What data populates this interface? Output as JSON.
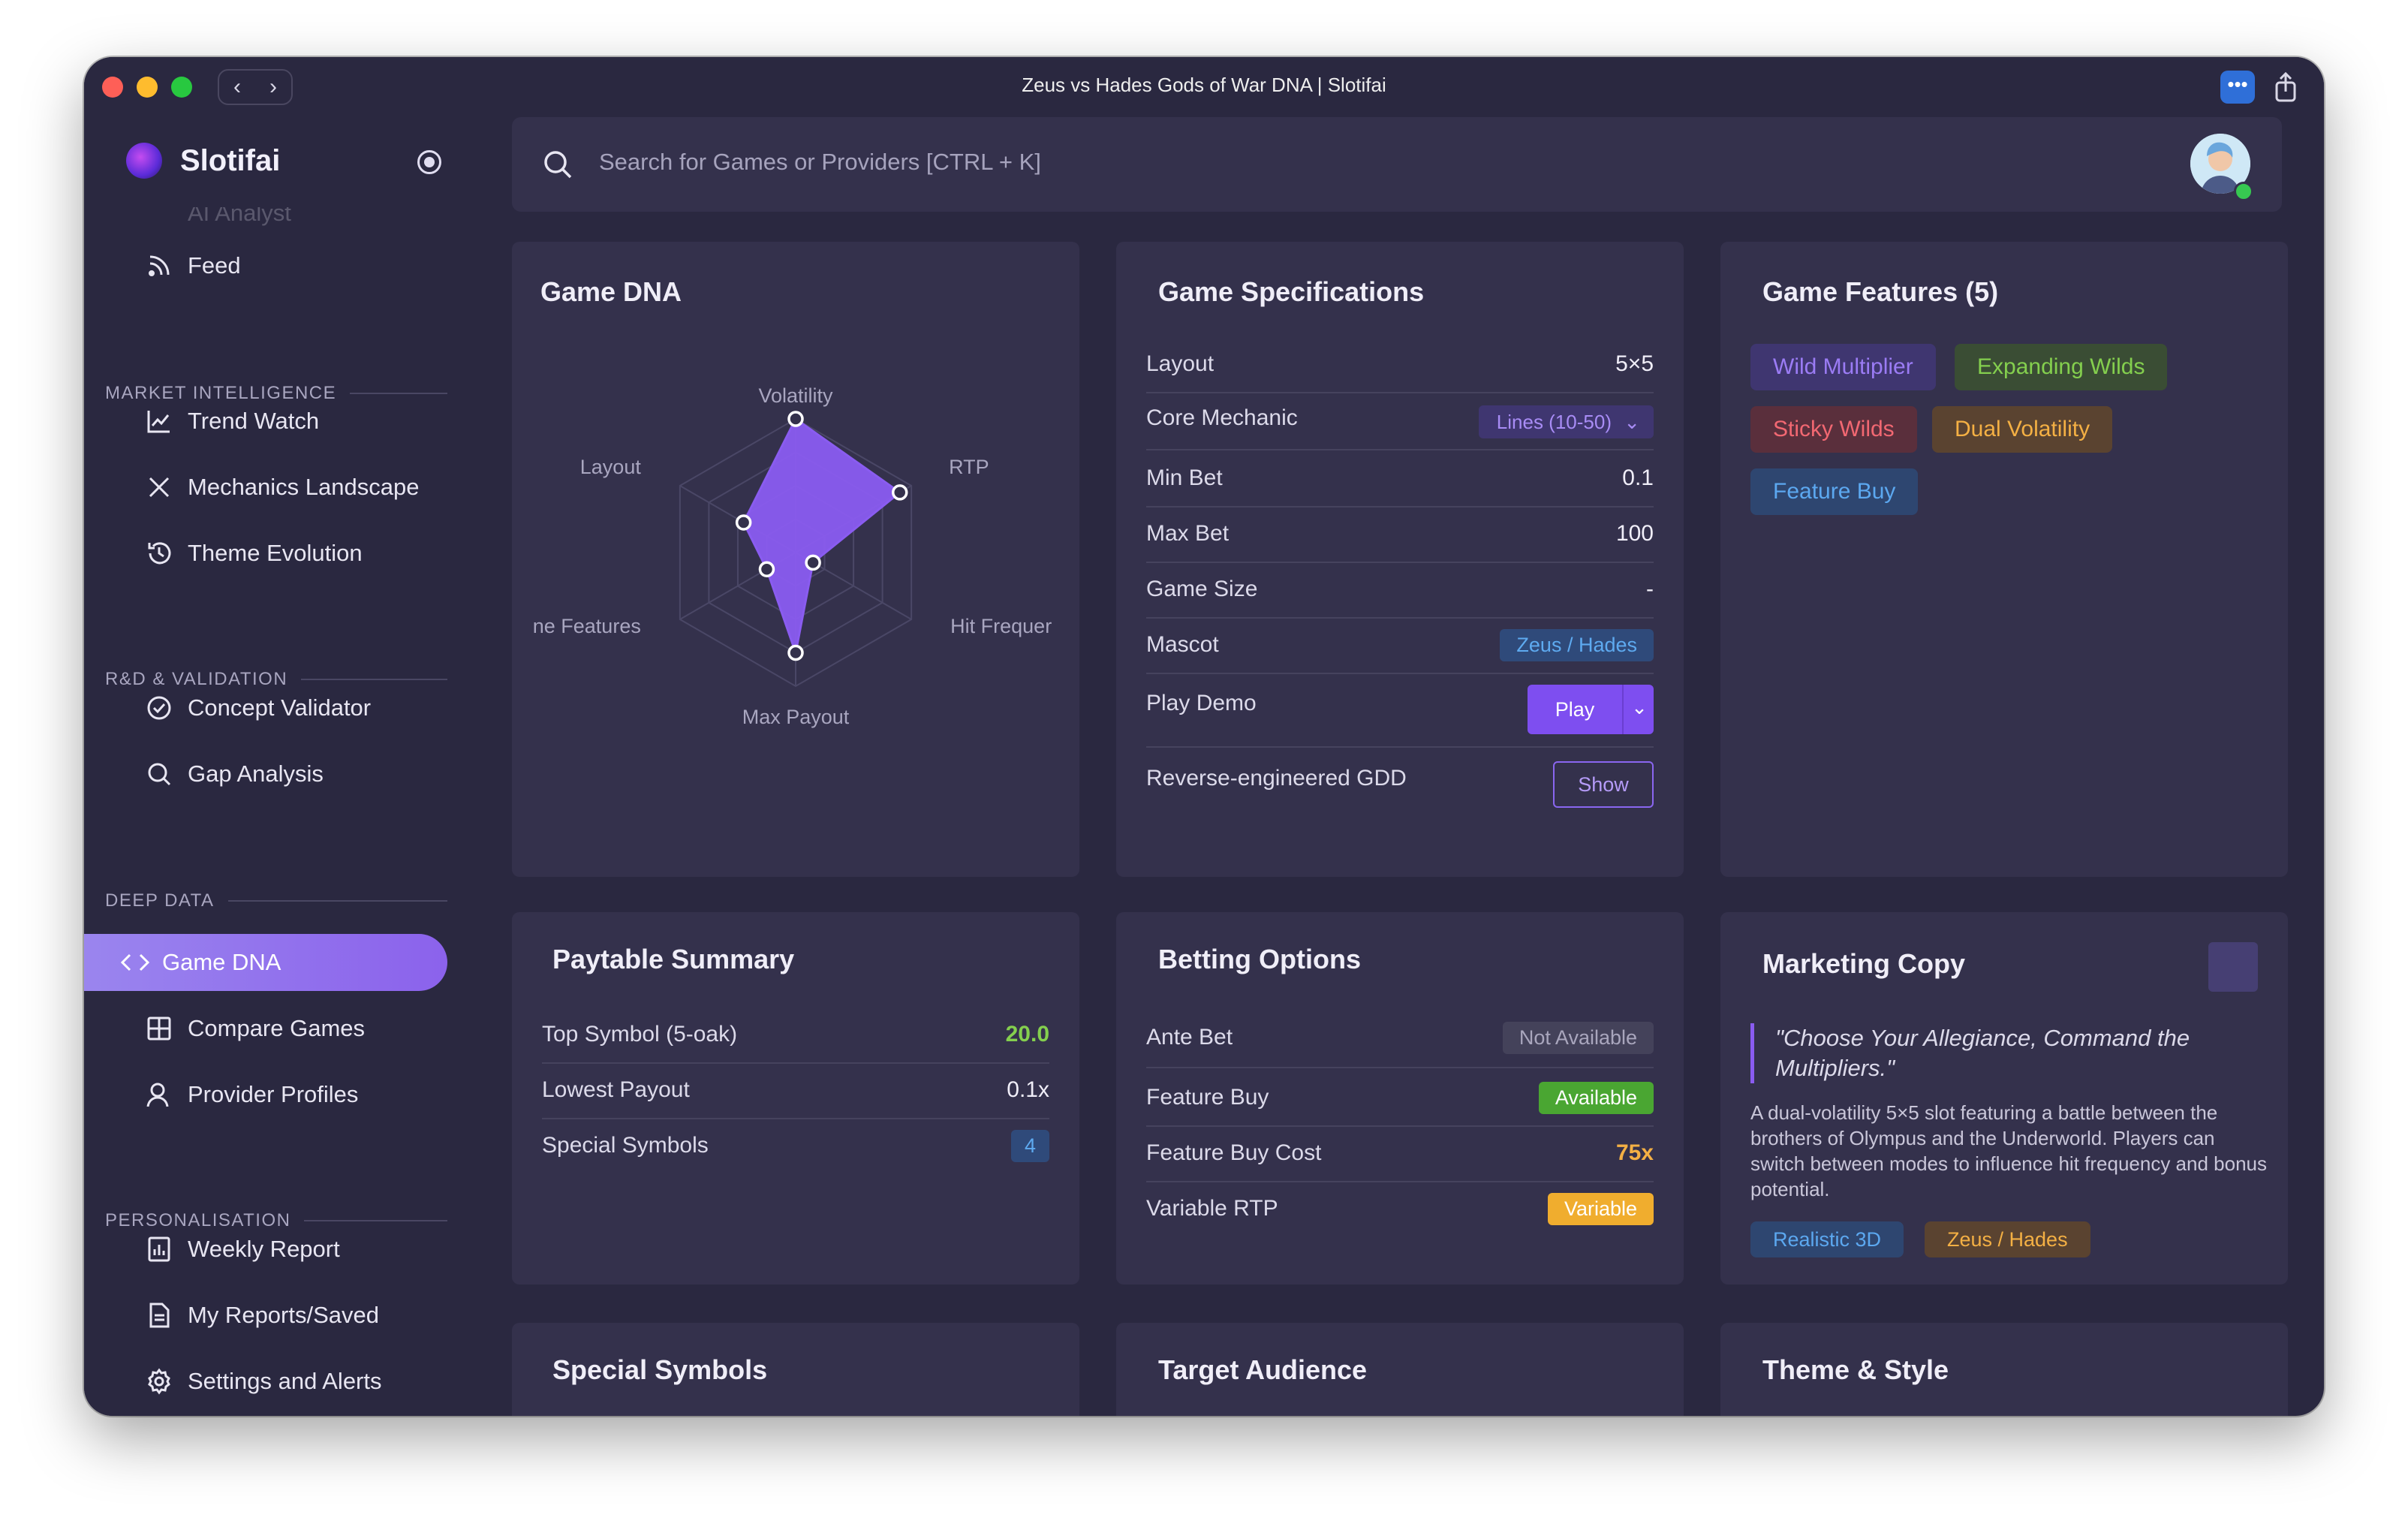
{
  "window": {
    "title": "Zeus vs Hades Gods of War DNA | Slotifai"
  },
  "brand": {
    "name": "Slotifai"
  },
  "search": {
    "placeholder": "Search for Games or Providers [CTRL + K]"
  },
  "sidebar": {
    "partial_item": "AI Analyst",
    "feed": "Feed",
    "sections": [
      {
        "label": "MARKET INTELLIGENCE",
        "items": [
          "Trend Watch",
          "Mechanics Landscape",
          "Theme Evolution"
        ]
      },
      {
        "label": "R&D & VALIDATION",
        "items": [
          "Concept Validator",
          "Gap Analysis"
        ]
      },
      {
        "label": "DEEP DATA",
        "items": [
          "Game DNA",
          "Compare Games",
          "Provider Profiles"
        ]
      },
      {
        "label": "PERSONALISATION",
        "items": [
          "Weekly Report",
          "My Reports/Saved",
          "Settings and Alerts"
        ]
      }
    ],
    "active": "Game DNA"
  },
  "game_dna": {
    "title": "Game DNA",
    "axes": [
      "Volatility",
      "RTP",
      "Hit Frequer",
      "Max Payout",
      "ne Features",
      "Layout"
    ],
    "values": [
      1.0,
      0.9,
      0.15,
      0.75,
      0.25,
      0.45
    ],
    "fill": "#8a5cf0"
  },
  "specs": {
    "title": "Game Specifications",
    "layout_label": "Layout",
    "layout_value": "5×5",
    "core_label": "Core Mechanic",
    "core_value": "Lines (10-50)",
    "minbet_label": "Min Bet",
    "minbet_value": "0.1",
    "maxbet_label": "Max Bet",
    "maxbet_value": "100",
    "size_label": "Game Size",
    "size_value": "-",
    "mascot_label": "Mascot",
    "mascot_value": "Zeus / Hades",
    "demo_label": "Play Demo",
    "demo_button": "Play",
    "gdd_label": "Reverse-engineered GDD",
    "gdd_button": "Show"
  },
  "features": {
    "title": "Game Features (5)",
    "tags": [
      "Wild Multiplier",
      "Expanding Wilds",
      "Sticky Wilds",
      "Dual Volatility",
      "Feature Buy"
    ]
  },
  "paytable": {
    "title": "Paytable Summary",
    "top_label": "Top Symbol (5-oak)",
    "top_value": "20.0",
    "low_label": "Lowest Payout",
    "low_value": "0.1x",
    "special_label": "Special Symbols",
    "special_value": "4"
  },
  "betting": {
    "title": "Betting Options",
    "ante_label": "Ante Bet",
    "ante_value": "Not Available",
    "buy_label": "Feature Buy",
    "buy_value": "Available",
    "cost_label": "Feature Buy Cost",
    "cost_value": "75x",
    "rtp_label": "Variable RTP",
    "rtp_value": "Variable"
  },
  "marketing": {
    "title": "Marketing Copy",
    "quote": "\"Choose Your Allegiance, Command the Multipliers.\"",
    "body": "A dual-volatility 5×5 slot featuring a battle between the brothers of Olympus and the Underworld. Players can switch between modes to influence hit frequency and bonus potential.",
    "tags": [
      "Realistic 3D",
      "Zeus / Hades"
    ]
  },
  "bottom_cards": {
    "special": "Special Symbols",
    "audience": "Target Audience",
    "theme": "Theme & Style"
  }
}
